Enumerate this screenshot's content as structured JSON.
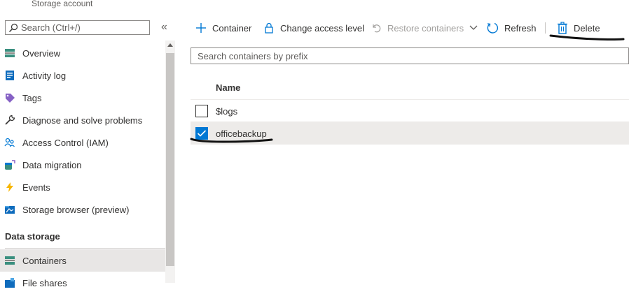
{
  "sidebar": {
    "subtitle": "Storage account",
    "search_placeholder": "Search (Ctrl+/)",
    "collapse_glyph": "«",
    "items": [
      {
        "label": "Overview"
      },
      {
        "label": "Activity log"
      },
      {
        "label": "Tags"
      },
      {
        "label": "Diagnose and solve problems"
      },
      {
        "label": "Access Control (IAM)"
      },
      {
        "label": "Data migration"
      },
      {
        "label": "Events"
      },
      {
        "label": "Storage browser (preview)"
      }
    ],
    "section": "Data storage",
    "section_items": [
      {
        "label": "Containers"
      },
      {
        "label": "File shares"
      }
    ]
  },
  "toolbar": {
    "add_container": "Container",
    "change_access": "Change access level",
    "restore": "Restore containers",
    "refresh": "Refresh",
    "delete": "Delete"
  },
  "filter": {
    "placeholder": "Search containers by prefix"
  },
  "table": {
    "column_name": "Name",
    "rows": [
      {
        "name": "$logs",
        "checked": false
      },
      {
        "name": "officebackup",
        "checked": true
      }
    ]
  },
  "colors": {
    "accent": "#0078d4",
    "selected_bg": "#edebe9",
    "annotation": "#111111"
  }
}
